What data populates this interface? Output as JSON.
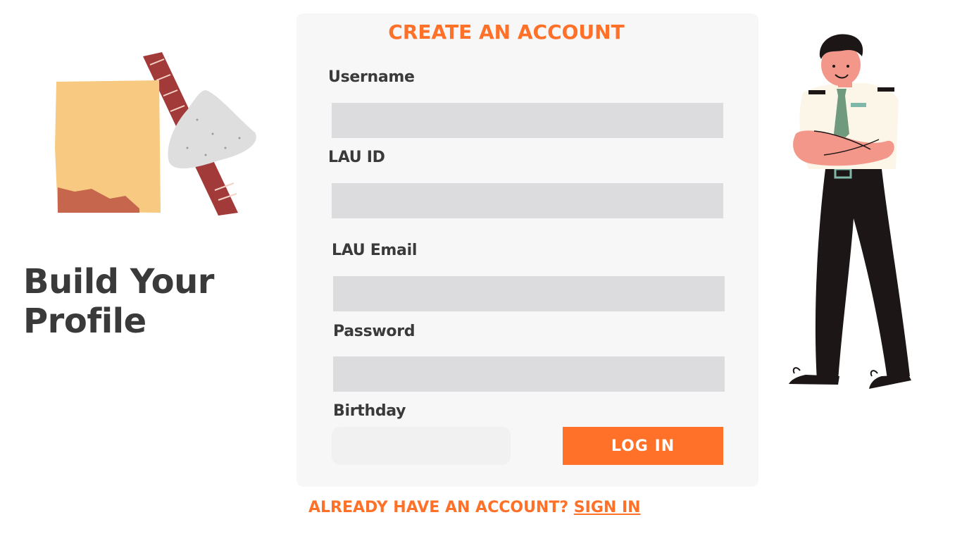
{
  "hero": {
    "title_line1": "Build Your",
    "title_line2": "Profile"
  },
  "form": {
    "title": "CREATE AN ACCOUNT",
    "fields": [
      {
        "label": "Username",
        "value": ""
      },
      {
        "label": "LAU ID",
        "value": ""
      },
      {
        "label": "LAU Email",
        "value": ""
      },
      {
        "label": "Password",
        "value": ""
      },
      {
        "label": "Birthday",
        "value": ""
      }
    ],
    "submit_label": "LOG IN"
  },
  "footer": {
    "prompt": "ALREADY HAVE AN ACCOUNT?",
    "link_label": "SIGN IN"
  },
  "colors": {
    "accent": "#ff7029",
    "text_dark": "#3a3a3a",
    "card_bg": "#f7f7f7",
    "input_bg": "#dcdcde"
  }
}
